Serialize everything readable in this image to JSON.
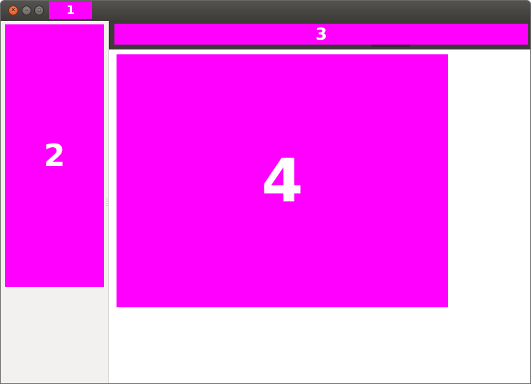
{
  "window": {
    "controls": {
      "close": "✕",
      "minimize": "–",
      "maximize": "▫"
    }
  },
  "markers": {
    "m1": "1",
    "m2": "2",
    "m3": "3",
    "m4": "4"
  },
  "colors": {
    "marker": "#ff00ff",
    "titlebar": "#3c3b37",
    "sidebar": "#f2f1f0",
    "close_button": "#df4a16"
  }
}
